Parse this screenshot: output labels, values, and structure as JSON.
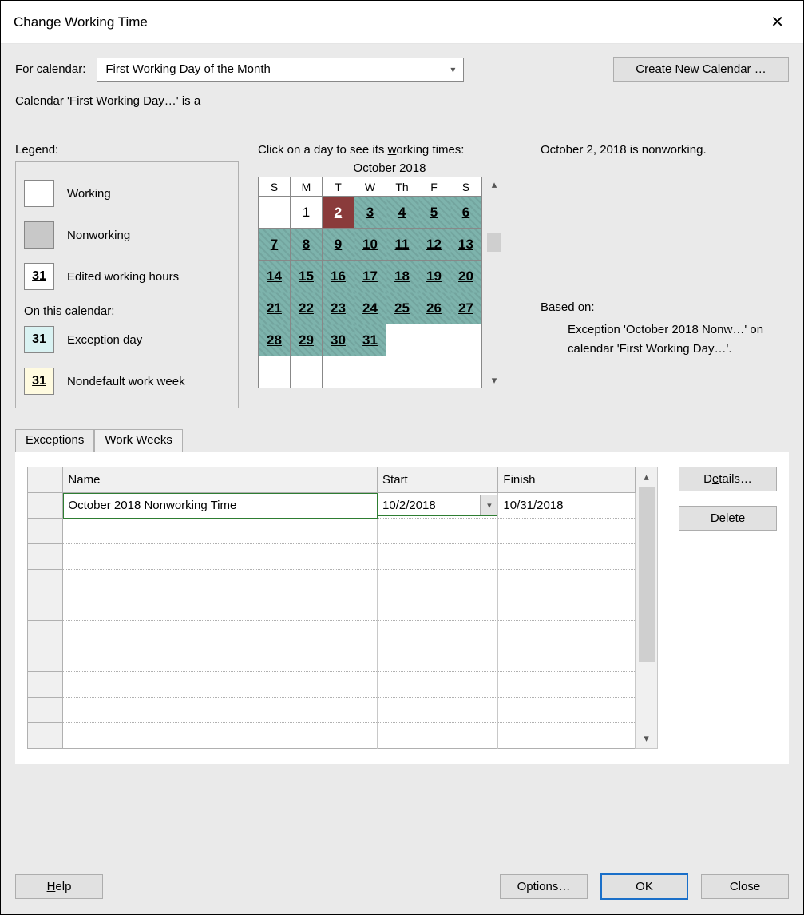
{
  "titlebar": {
    "title": "Change Working Time"
  },
  "top": {
    "for_calendar_label_a": "For ",
    "for_calendar_label_u": "c",
    "for_calendar_label_b": "alendar:",
    "combo_value": "First Working Day of the Month",
    "new_cal_a": "Create ",
    "new_cal_u": "N",
    "new_cal_b": "ew Calendar …"
  },
  "desc": "Calendar 'First Working Day…' is a",
  "legend": {
    "title": "Legend:",
    "working": "Working",
    "nonworking": "Nonworking",
    "edited_num": "31",
    "edited": "Edited working hours",
    "sub": "On this calendar:",
    "exc_num": "31",
    "exc": "Exception day",
    "nondef_num": "31",
    "nondef": "Nondefault work week"
  },
  "calendar": {
    "click_a": "Click on a day to see its ",
    "click_u": "w",
    "click_b": "orking times:",
    "month": "October 2018",
    "dow": [
      "S",
      "M",
      "T",
      "W",
      "Th",
      "F",
      "S"
    ],
    "weeks": [
      [
        {
          "n": "",
          "c": "plain"
        },
        {
          "n": "1",
          "c": "plain"
        },
        {
          "n": "2",
          "c": "sel"
        },
        {
          "n": "3",
          "c": "exc"
        },
        {
          "n": "4",
          "c": "exc"
        },
        {
          "n": "5",
          "c": "exc"
        },
        {
          "n": "6",
          "c": "exc"
        }
      ],
      [
        {
          "n": "7",
          "c": "exc"
        },
        {
          "n": "8",
          "c": "exc"
        },
        {
          "n": "9",
          "c": "exc"
        },
        {
          "n": "10",
          "c": "exc"
        },
        {
          "n": "11",
          "c": "exc"
        },
        {
          "n": "12",
          "c": "exc"
        },
        {
          "n": "13",
          "c": "exc"
        }
      ],
      [
        {
          "n": "14",
          "c": "exc"
        },
        {
          "n": "15",
          "c": "exc"
        },
        {
          "n": "16",
          "c": "exc"
        },
        {
          "n": "17",
          "c": "exc"
        },
        {
          "n": "18",
          "c": "exc"
        },
        {
          "n": "19",
          "c": "exc"
        },
        {
          "n": "20",
          "c": "exc"
        }
      ],
      [
        {
          "n": "21",
          "c": "exc"
        },
        {
          "n": "22",
          "c": "exc"
        },
        {
          "n": "23",
          "c": "exc"
        },
        {
          "n": "24",
          "c": "exc"
        },
        {
          "n": "25",
          "c": "exc"
        },
        {
          "n": "26",
          "c": "exc"
        },
        {
          "n": "27",
          "c": "exc"
        }
      ],
      [
        {
          "n": "28",
          "c": "exc"
        },
        {
          "n": "29",
          "c": "exc"
        },
        {
          "n": "30",
          "c": "exc"
        },
        {
          "n": "31",
          "c": "exc"
        },
        {
          "n": "",
          "c": "plain"
        },
        {
          "n": "",
          "c": "plain"
        },
        {
          "n": "",
          "c": "plain"
        }
      ],
      [
        {
          "n": "",
          "c": "plain"
        },
        {
          "n": "",
          "c": "plain"
        },
        {
          "n": "",
          "c": "plain"
        },
        {
          "n": "",
          "c": "plain"
        },
        {
          "n": "",
          "c": "plain"
        },
        {
          "n": "",
          "c": "plain"
        },
        {
          "n": "",
          "c": "plain"
        }
      ]
    ]
  },
  "right": {
    "status": "October 2, 2018 is nonworking.",
    "based_label": "Based on:",
    "based_text": "Exception 'October 2018 Nonw…' on calendar 'First Working Day…'."
  },
  "tabs": {
    "exceptions": "Exceptions",
    "workweeks": "Work Weeks"
  },
  "grid": {
    "headers": {
      "name": "Name",
      "start": "Start",
      "finish": "Finish"
    },
    "rows": [
      {
        "name": "October 2018 Nonworking Time",
        "start": "10/2/2018",
        "finish": "10/31/2018"
      }
    ]
  },
  "side": {
    "details_a": "D",
    "details_u": "e",
    "details_b": "tails…",
    "delete_u": "D",
    "delete_b": "elete"
  },
  "footer": {
    "help_u": "H",
    "help_b": "elp",
    "options": "Options…",
    "ok": "OK",
    "close": "Close"
  }
}
